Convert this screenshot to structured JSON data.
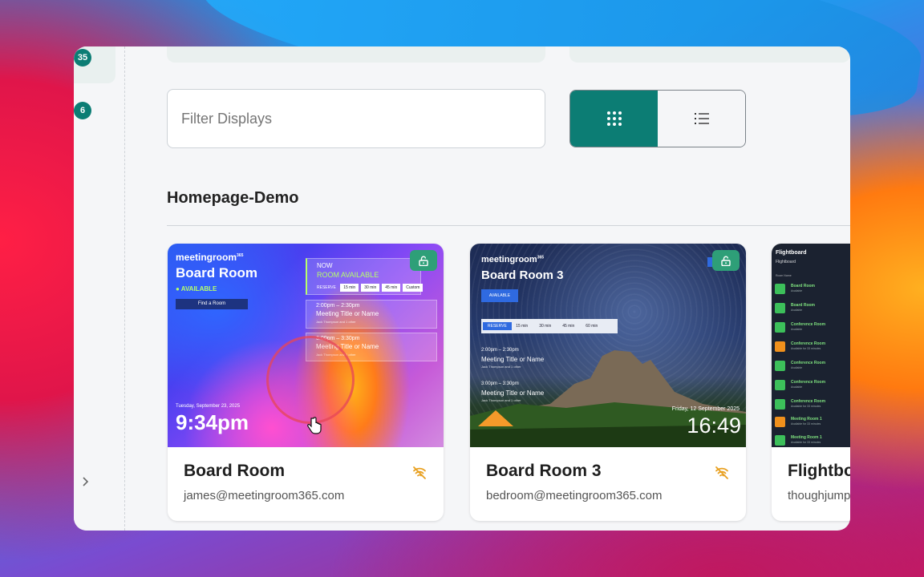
{
  "sidebar": {
    "badges": [
      "35",
      "6"
    ]
  },
  "filter": {
    "placeholder": "Filter Displays"
  },
  "view_toggle": {
    "active": "grid",
    "grid_icon": "grid-icon",
    "list_icon": "list-icon"
  },
  "colors": {
    "accent": "#0c7d74",
    "lock": "#2e9f78",
    "offline": "#e8a020"
  },
  "section": {
    "title": "Homepage-Demo"
  },
  "cards": [
    {
      "name": "Board Room",
      "email": "james@meetingroom365.com",
      "status_icon": "wifi-off-icon",
      "thumb": {
        "brand": "meetingroom",
        "brand_sup": "365",
        "room": "Board Room",
        "status": "● AVAILABLE",
        "button": "Find a Room",
        "now_label": "NOW",
        "now_status": "ROOM AVAILABLE",
        "reserve_label": "RESERVE",
        "reserve_options": [
          "15 min",
          "30 min",
          "45 min",
          "Custom"
        ],
        "events": [
          {
            "time": "2:00pm – 2:30pm",
            "title": "Meeting Title or Name",
            "attendees": "Jack Thompson and 1 other"
          },
          {
            "time": "3:00pm – 3:30pm",
            "title": "Meeting Title or Name",
            "attendees": "Jack Thompson and 1 other"
          }
        ],
        "date": "Tuesday, September 23, 2025",
        "time": "9:34pm"
      }
    },
    {
      "name": "Board Room 3",
      "email": "bedroom@meetingroom365.com",
      "status_icon": "wifi-off-icon",
      "thumb": {
        "brand": "meetingroom",
        "brand_sup": "365",
        "room": "Board Room 3",
        "status": "AVAILABLE",
        "reserve_label": "RESERVE",
        "reserve_options": [
          "15 min",
          "30 min",
          "45 min",
          "60 min"
        ],
        "events": [
          {
            "time": "2:00pm – 2:30pm",
            "title": "Meeting Title or Name",
            "attendees": "Jack Thompson and 1 other"
          },
          {
            "time": "3:00pm – 3:30pm",
            "title": "Meeting Title or Name",
            "attendees": "Jack Thompson and 1 other"
          }
        ],
        "date": "Friday, 12 September 2025",
        "time": "16:49"
      }
    },
    {
      "name": "Flightbo",
      "email": "thoughjump",
      "thumb": {
        "title": "Flightboard",
        "subtitle": "Flightboard",
        "header": "Room Name",
        "rooms": [
          {
            "name": "Board Room",
            "status": "Available",
            "color": "#3cbf5a"
          },
          {
            "name": "Board Room",
            "status": "Available",
            "color": "#3cbf5a"
          },
          {
            "name": "Conference Room",
            "status": "Available",
            "color": "#3cbf5a"
          },
          {
            "name": "Conference Room",
            "status": "Available for 33 minutes",
            "color": "#f0901c"
          },
          {
            "name": "Conference Room",
            "status": "Available",
            "color": "#3cbf5a"
          },
          {
            "name": "Conference Room",
            "status": "Available",
            "color": "#3cbf5a"
          },
          {
            "name": "Conference Room",
            "status": "Available for 33 minutes",
            "color": "#3cbf5a"
          },
          {
            "name": "Meeting Room 1",
            "status": "Available for 33 minutes",
            "color": "#f0901c"
          },
          {
            "name": "Meeting Room 1",
            "status": "Available for 33 minutes",
            "color": "#3cbf5a"
          }
        ]
      }
    }
  ]
}
